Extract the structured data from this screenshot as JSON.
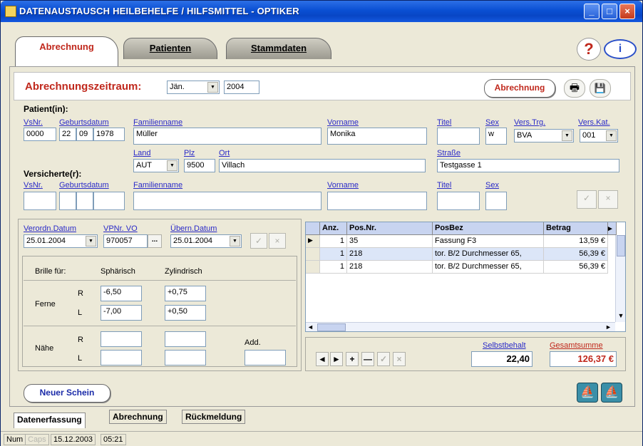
{
  "window": {
    "title": "DATENAUSTAUSCH HEILBEHELFE / HILFSMITTEL  -  OPTIKER",
    "minimize": "_",
    "maximize": "□",
    "close": "×"
  },
  "tabs": [
    {
      "label": "Abrechnung"
    },
    {
      "label": "Patienten"
    },
    {
      "label": "Stammdaten"
    }
  ],
  "help": {
    "icon": "?",
    "info": "i"
  },
  "period": {
    "label": "Abrechnungszeitraum:",
    "month": "Jän.",
    "year": "2004"
  },
  "actions": {
    "abrechnung": "Abrechnung"
  },
  "patient": {
    "heading": "Patient(in):",
    "labels": {
      "vsnr": "VsNr.",
      "geburtsdatum": "Geburtsdatum",
      "familienname": "Familienname",
      "vorname": "Vorname",
      "titel": "Titel",
      "sex": "Sex",
      "vers_trg": "Vers.Trg.",
      "vers_kat": "Vers.Kat.",
      "land": "Land",
      "plz": "Plz",
      "ort": "Ort",
      "strasse": "Straße"
    },
    "vsnr": "0000",
    "geb_tag": "22",
    "geb_monat": "09",
    "geb_jahr": "1978",
    "familienname": "Müller",
    "vorname": "Monika",
    "titel": "",
    "sex": "w",
    "vers_trg": "BVA",
    "vers_kat": "001",
    "land": "AUT",
    "plz": "9500",
    "ort": "Villach",
    "strasse": "Testgasse 1"
  },
  "versicherte": {
    "heading": "Versicherte(r):",
    "labels": {
      "vsnr": "VsNr.",
      "geburtsdatum": "Geburtsdatum",
      "familienname": "Familienname",
      "vorname": "Vorname",
      "titel": "Titel",
      "sex": "Sex"
    }
  },
  "verordnung": {
    "labels": {
      "datum": "Verordn.Datum",
      "vpnr": "VPNr. VO",
      "uebern": "Übern.Datum"
    },
    "datum": "25.01.2004",
    "vpnr": "970057",
    "vpnr_btn": "...",
    "uebern": "25.01.2004"
  },
  "brille": {
    "labels": {
      "fuer": "Brille für:",
      "sph": "Sphärisch",
      "zyl": "Zylindrisch",
      "ferne": "Ferne",
      "naehe": "Nähe",
      "r": "R",
      "l": "L",
      "add": "Add."
    },
    "ferne_r_sph": "-6,50",
    "ferne_r_zyl": "+0,75",
    "ferne_l_sph": "-7,00",
    "ferne_l_zyl": "+0,50"
  },
  "positions": {
    "columns": [
      "Anz.",
      "Pos.Nr.",
      "PosBez",
      "Betrag"
    ],
    "rows": [
      {
        "anz": "1",
        "posnr": "35",
        "bez": "Fassung F3",
        "betrag": "13,59 €"
      },
      {
        "anz": "1",
        "posnr": "218",
        "bez": "tor. B/2 Durchmesser 65,",
        "betrag": "56,39 €"
      },
      {
        "anz": "1",
        "posnr": "218",
        "bez": "tor. B/2 Durchmesser 65,",
        "betrag": "56,39 €"
      }
    ]
  },
  "totals": {
    "selbstbehalt_label": "Selbstbehalt",
    "selbstbehalt": "22,40",
    "gesamt_label": "Gesamtsumme",
    "gesamt": "126,37 €"
  },
  "nav": {
    "prev": "◄",
    "next": "►",
    "add": "+",
    "del": "—",
    "ok": "✓",
    "cancel": "×"
  },
  "neuer_schein": "Neuer Schein",
  "bottom_tabs": [
    "Datenerfassung",
    "Abrechnung",
    "Rückmeldung"
  ],
  "status": {
    "num": "Num",
    "caps": "Caps",
    "date": "15.12.2003",
    "time": "05:21"
  }
}
